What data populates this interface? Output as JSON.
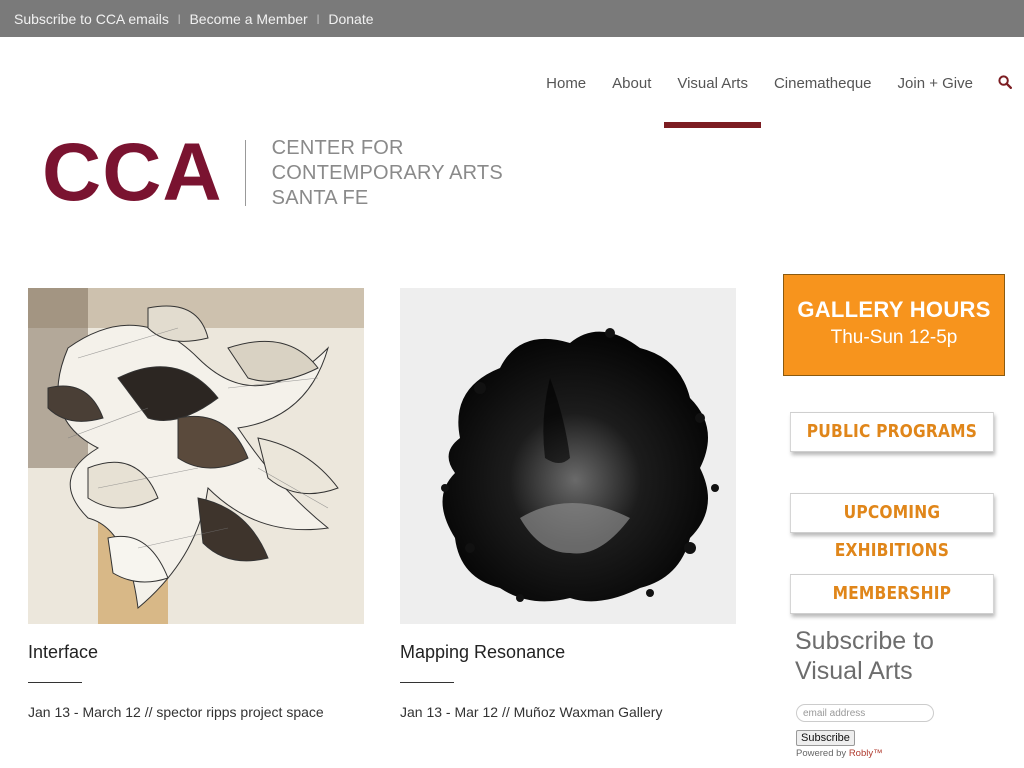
{
  "topbar": {
    "links": [
      {
        "label": "Subscribe to CCA emails"
      },
      {
        "label": "Become a Member"
      },
      {
        "label": "Donate"
      }
    ],
    "separator": "|"
  },
  "nav": {
    "items": [
      {
        "label": "Home",
        "active": false
      },
      {
        "label": "About",
        "active": false
      },
      {
        "label": "Visual Arts",
        "active": true
      },
      {
        "label": "Cinematheque",
        "active": false
      },
      {
        "label": "Join + Give",
        "active": false
      }
    ],
    "search_icon": "search-icon",
    "accent_color": "#7c1d22"
  },
  "logo": {
    "mark": "CCA",
    "line1": "CENTER FOR",
    "line2": "CONTEMPORARY ARTS",
    "line3": "SANTA FE",
    "brand_color": "#7a1330"
  },
  "exhibitions": [
    {
      "title": "Interface",
      "dates": "Jan 13 - March 12 // spector ripps project space",
      "image": "paper-sculpture-artwork"
    },
    {
      "title": "Mapping Resonance",
      "dates": "Jan 13 - Mar 12 // Muñoz Waxman Gallery",
      "image": "ink-blot-artwork"
    }
  ],
  "sidebar": {
    "hours_title": "GALLERY HOURS",
    "hours_value": "Thu-Sun 12-5p",
    "hours_color": "#f7941d",
    "buttons": [
      {
        "label": "PUBLIC PROGRAMS"
      },
      {
        "label": "UPCOMING EXHIBITIONS"
      },
      {
        "label": "MEMBERSHIP"
      }
    ],
    "button_color": "#e0861a",
    "subscribe_heading_1": "Subscribe to",
    "subscribe_heading_2": "Visual Arts",
    "email_placeholder": "email address",
    "subscribe_button": "Subscribe",
    "powered_prefix": "Powered by ",
    "powered_brand": "Robly™"
  }
}
